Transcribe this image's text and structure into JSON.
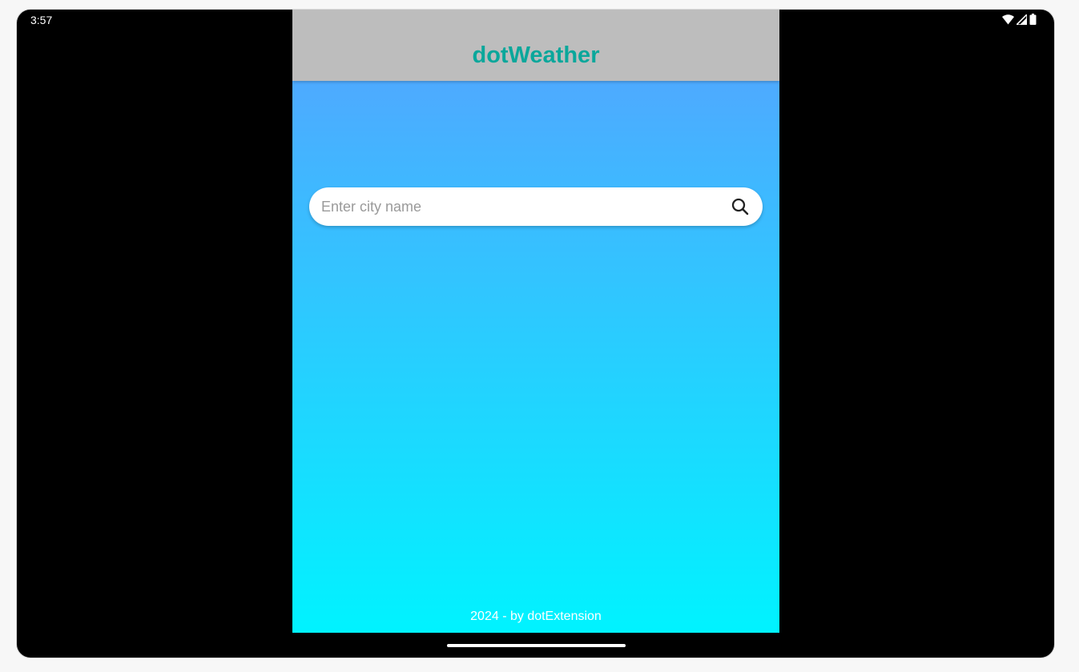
{
  "status_bar": {
    "time": "3:57",
    "icons": [
      "wifi-icon",
      "signal-icon",
      "battery-icon"
    ]
  },
  "app_bar": {
    "title": "dotWeather",
    "title_color": "#0aa79b",
    "background": "#bdbdbd"
  },
  "search": {
    "placeholder": "Enter city name",
    "value": "",
    "icon": "search-icon"
  },
  "footer": {
    "text": "2024 - by dotExtension"
  },
  "colors": {
    "gradient_top": "#4eaaff",
    "gradient_bottom": "#00f3ff"
  }
}
